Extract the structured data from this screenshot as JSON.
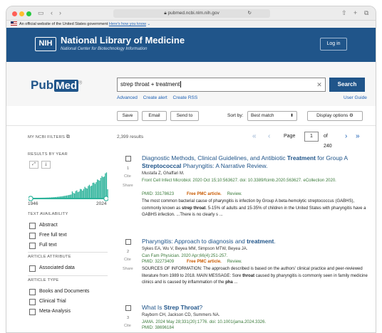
{
  "browser": {
    "url": "pubmed.ncbi.nlm.nih.gov"
  },
  "gov_banner": {
    "text": "An official website of the United States government",
    "link": "Here's how you know"
  },
  "header": {
    "logo": "NIH",
    "title": "National Library of Medicine",
    "subtitle": "National Center for Biotechnology Information",
    "login": "Log in"
  },
  "search": {
    "logo_left": "Pub",
    "logo_right": "Med",
    "logo_reg": "®",
    "query": "strep throat + treatment",
    "button": "Search",
    "links": [
      "Advanced",
      "Create alert",
      "Create RSS"
    ],
    "guide": "User Guide"
  },
  "toolbar": {
    "save": "Save",
    "email": "Email",
    "send_to": "Send to",
    "sort_label": "Sort by:",
    "sort_value": "Best match",
    "display": "Display options"
  },
  "sidebar": {
    "filters_title": "MY NCBI FILTERS",
    "results_by_year": "RESULTS BY YEAR",
    "year_start": "1946",
    "year_end": "2024",
    "text_availability": "TEXT AVAILABILITY",
    "text_items": [
      "Abstract",
      "Free full text",
      "Full text"
    ],
    "article_attribute": "ARTICLE ATTRIBUTE",
    "attr_items": [
      "Associated data"
    ],
    "article_type": "ARTICLE TYPE",
    "type_items": [
      "Books and Documents",
      "Clinical Trial",
      "Meta-Analysis"
    ]
  },
  "results": {
    "count": "2,399 results",
    "page_label": "Page",
    "page": "1",
    "of_pages": "of 240",
    "cite": "Cite",
    "share": "Share",
    "articles": [
      {
        "num": "1",
        "title_a": "Diagnostic Methods, Clinical Guidelines, and Antibiotic ",
        "title_b": "Treatment",
        "title_c": " for Group A ",
        "title_d": "Streptococcal",
        "title_e": " Pharyngitis: A Narrative Review.",
        "authors": "Mustafa Z, Ghaffari M.",
        "journal": "Front Cell Infect Microbiol. 2020 Oct 15;10:563627. doi: 10.3389/fcimb.2020.563627. eCollection 2020.",
        "pmid": "PMID: 33178623",
        "free": "Free PMC article.",
        "review": "Review.",
        "snippet_a": "The most common bacterial cause of pharyngitis is infection by Group A beta-hemolytic streptococcus (GABHS), commonly known as ",
        "snippet_b": "strep throat",
        "snippet_c": ". 5-15% of adults and 15-35% of children in the United States with pharyngitis have a GABHS infection. ...There is no clearly s ..."
      },
      {
        "num": "2",
        "title_a": "Pharyngitis: Approach to diagnosis and ",
        "title_b": "treatment",
        "title_c": ".",
        "authors": "Sykes EA, Wu V, Beyea MM, Simpson MTW, Beyea JA.",
        "journal": "Can Fam Physician. 2020 Apr;66(4):251-257.",
        "pmid": "PMID: 32273409",
        "free": "Free PMC article.",
        "review": "Review.",
        "snippet_a": "SOURCES OF INFORMATION: The approach described is based on the authors' clinical practice and peer-reviewed literature from 1989 to 2018. MAIN MESSAGE: Sore ",
        "snippet_b": "throat",
        "snippet_c": " caused by pharyngitis is commonly seen in family medicine clinics and is caused by inflammation of the ",
        "snippet_d": "pha",
        "snippet_e": " ..."
      },
      {
        "num": "3",
        "title_a": "What Is ",
        "title_b": "Strep Throat",
        "title_c": "?",
        "authors": "Rayborn CH, Jackson CD, Summers NA.",
        "journal": "JAMA. 2024 May 28;331(20):1776. doi: 10.1001/jama.2024.3326.",
        "pmid": "PMID: 38696184"
      }
    ]
  },
  "colors": {
    "brand": "#20558a",
    "link": "#1a5fb4",
    "free": "#c95a00",
    "journal": "#3a7a3a",
    "histogram": "#2db39b"
  }
}
